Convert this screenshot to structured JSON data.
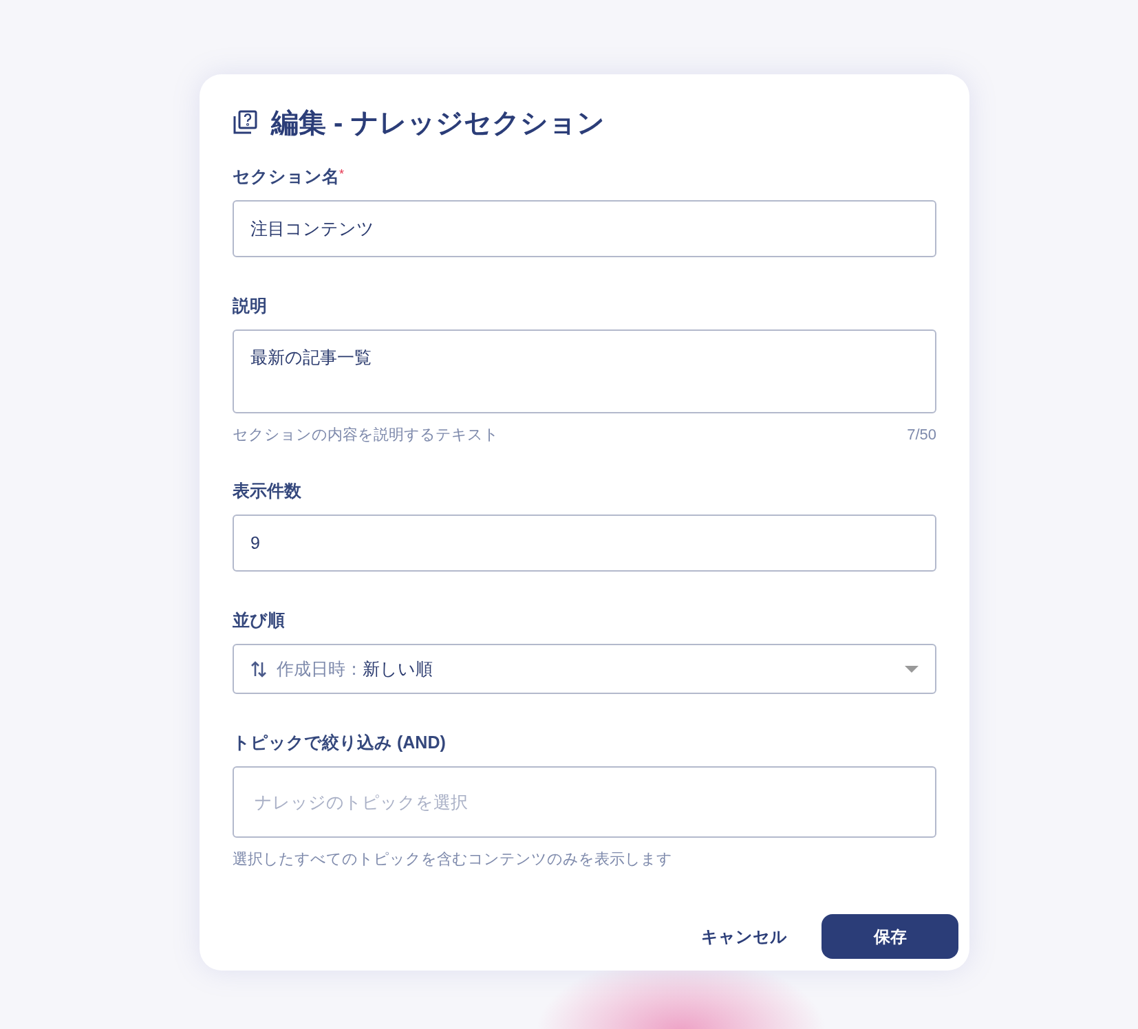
{
  "dialog": {
    "title": "編集 - ナレッジセクション",
    "fields": [
      {
        "kind": "text",
        "label": "セクション名",
        "required_mark": "*",
        "value": "注目コンテンツ"
      },
      {
        "kind": "textarea",
        "label": "説明",
        "value": "最新の記事一覧",
        "helper": "セクションの内容を説明するテキスト",
        "counter": "7/50"
      },
      {
        "kind": "text",
        "label": "表示件数",
        "value": "9"
      },
      {
        "kind": "select",
        "label": "並び順",
        "prefix": "作成日時：",
        "value": "新しい順"
      },
      {
        "kind": "multiselect",
        "label": "トピックで絞り込み (AND)",
        "placeholder": "ナレッジのトピックを選択",
        "helper": "選択したすべてのトピックを含むコンテンツのみを表示します"
      }
    ],
    "buttons": [
      {
        "kind": "text",
        "label": "キャンセル"
      },
      {
        "kind": "primary",
        "label": "保存"
      }
    ]
  }
}
